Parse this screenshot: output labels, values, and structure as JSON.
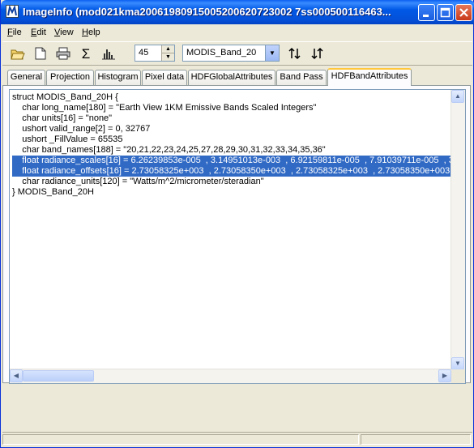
{
  "window": {
    "title": "ImageInfo (mod021kma20061980915005200620723002 7ss000500116463...",
    "title_icon": "imageinfo-app-icon",
    "controls": [
      "minimize-icon",
      "maximize-icon",
      "close-icon"
    ]
  },
  "menu": {
    "items": [
      {
        "label": "File"
      },
      {
        "label": "Edit"
      },
      {
        "label": "View"
      },
      {
        "label": "Help"
      }
    ]
  },
  "toolbar": {
    "buttons": [
      "open-folder-icon",
      "new-document-icon",
      "print-icon",
      "sigma-icon",
      "histogram-icon"
    ],
    "spin_value": "45",
    "band_select": "MODIS_Band_20",
    "sort_buttons": [
      "sort-ascending-icon",
      "sort-descending-icon"
    ]
  },
  "tabs": [
    {
      "label": "General"
    },
    {
      "label": "Projection"
    },
    {
      "label": "Histogram"
    },
    {
      "label": "Pixel data"
    },
    {
      "label": "HDFGlobalAttributes"
    },
    {
      "label": "Band Pass"
    },
    {
      "label": "HDFBandAttributes",
      "active": true
    }
  ],
  "content": {
    "lines": [
      "struct MODIS_Band_20H {",
      "    char long_name[180] = \"Earth View 1KM Emissive Bands Scaled Integers\"",
      "    char units[16] = \"none\"",
      "    ushort valid_range[2] = 0, 32767",
      "    ushort _FillValue = 65535",
      "    char band_names[188] = \"20,21,22,23,24,25,27,28,29,30,31,32,33,34,35,36\"",
      "    float radiance_scales[16] = 6.26239853e-005  , 3.14951013e-003  , 6.92159811e-005  , 7.91039711e-005  , 3.1",
      "    float radiance_offsets[16] = 2.73058325e+003  , 2.73058350e+003  , 2.73058325e+003  , 2.73058350e+003  , 2",
      "    char radiance_units[120] = \"Watts/m^2/micrometer/steradian\"",
      "} MODIS_Band_20H"
    ],
    "selected_lines": [
      6,
      7
    ]
  },
  "colors": {
    "titlebar": "#0058E6",
    "selection": "#316AC5",
    "window_bg": "#ECE9D8"
  }
}
